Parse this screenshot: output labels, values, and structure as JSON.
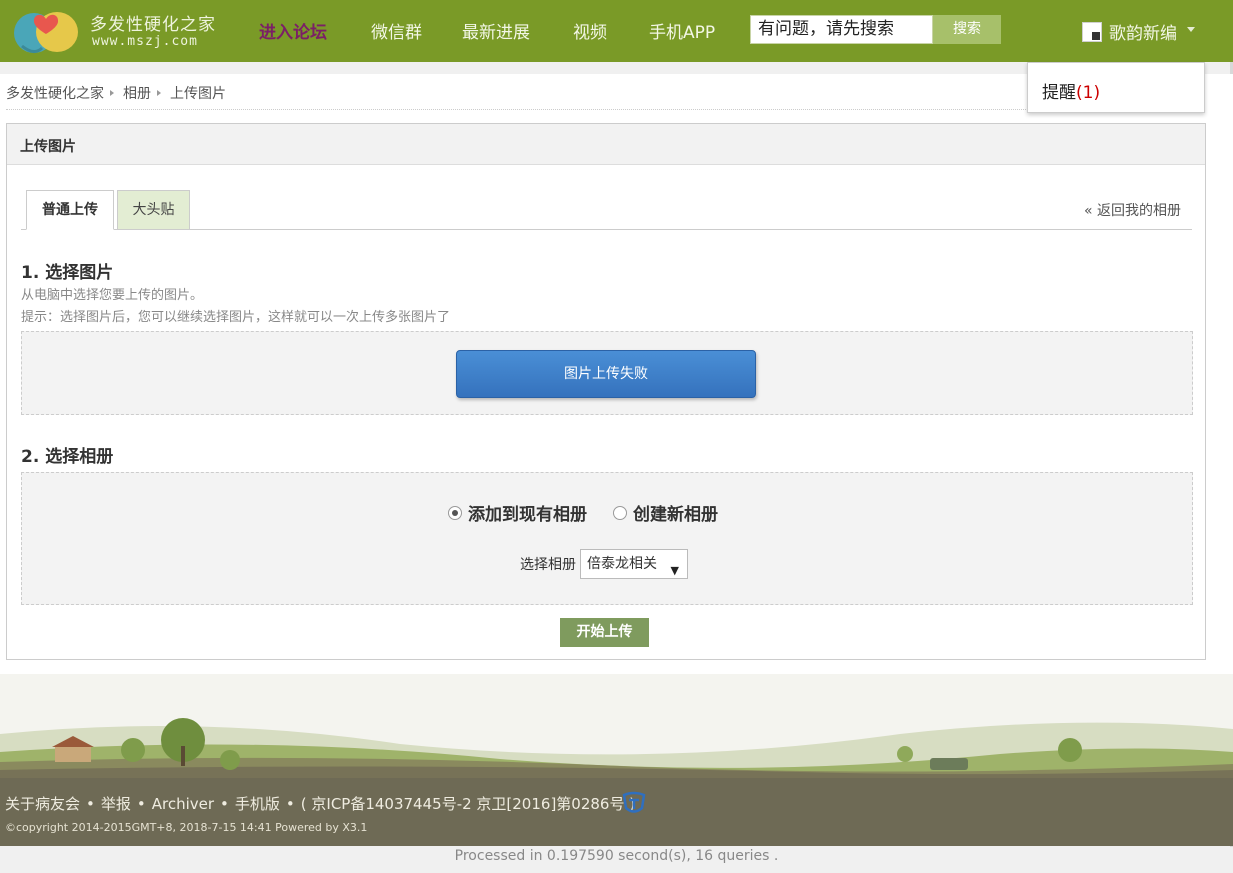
{
  "header": {
    "site_name": "多发性硬化之家",
    "site_url": "www.mszj.com",
    "nav": [
      {
        "label": "进入论坛",
        "active": true
      },
      {
        "label": "微信群",
        "active": false
      },
      {
        "label": "最新进展",
        "active": false
      },
      {
        "label": "视频",
        "active": false
      },
      {
        "label": "手机APP",
        "active": false
      }
    ],
    "search": {
      "value": "有问题，请先搜索",
      "button": "搜索"
    },
    "user": {
      "name": "歌韵新编",
      "icon": "avatar-icon"
    },
    "colors": {
      "bar": "#7a9a27",
      "active_nav": "#7b1f66"
    }
  },
  "dropdown": {
    "label": "提醒",
    "count": "(1)"
  },
  "breadcrumb": [
    "多发性硬化之家",
    "相册",
    "上传图片"
  ],
  "panel": {
    "title": "上传图片",
    "tabs": [
      {
        "label": "普通上传",
        "active": true
      },
      {
        "label": "大头贴",
        "active": false
      }
    ],
    "back_link": "« 返回我的相册",
    "step1": {
      "title": "1. 选择图片",
      "hint1": "从电脑中选择您要上传的图片。",
      "hint2": "提示：选择图片后，您可以继续选择图片，这样就可以一次上传多张图片了",
      "upload_button": "图片上传失败"
    },
    "step2": {
      "title": "2. 选择相册",
      "options": [
        {
          "label": "添加到现有相册",
          "checked": true
        },
        {
          "label": "创建新相册",
          "checked": false
        }
      ],
      "select_label": "选择相册",
      "select_value": "倍泰龙相关"
    },
    "start_button": "开始上传"
  },
  "footer": {
    "links": [
      "关于病友会",
      "举报",
      "Archiver",
      "手机版",
      "( 京ICP备14037445号-2 京卫[2016]第0286号 )"
    ],
    "copyright": "©copyright 2014-2015GMT+8, 2018-7-15 14:41 Powered by X3.1",
    "processed": "Processed in 0.197590 second(s), 16 queries ."
  }
}
